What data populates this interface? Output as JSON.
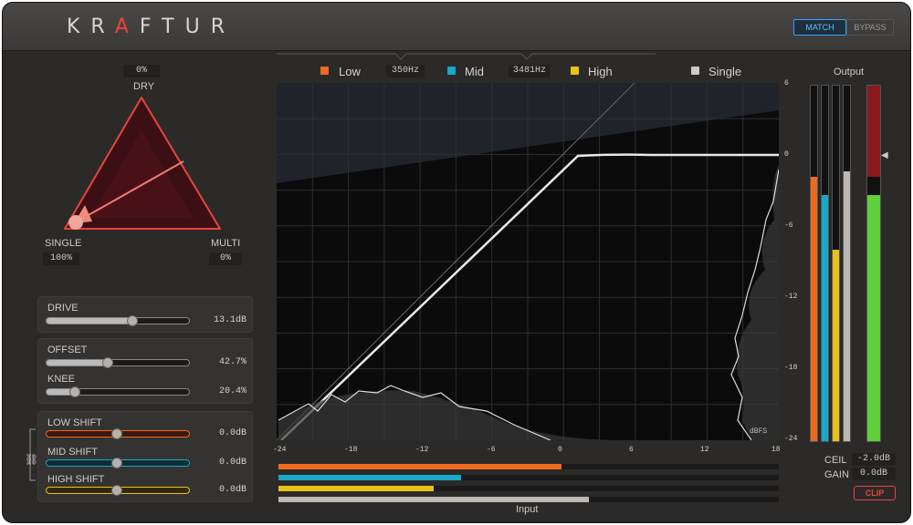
{
  "header": {
    "logo_left": "KR",
    "logo_accent": "A",
    "logo_right": "FTUR",
    "match_label": "MATCH",
    "bypass_label": "BYPASS"
  },
  "mix": {
    "dry_value": "0%",
    "dry_label": "DRY",
    "single_label": "SINGLE",
    "multi_label": "MULTI",
    "single_value": "100%",
    "multi_value": "0%"
  },
  "controls": {
    "drive_label": "DRIVE",
    "drive_value": "13.1dB",
    "drive_level": 0.6,
    "offset_label": "OFFSET",
    "offset_value": "42.7%",
    "offset_level": 0.43,
    "knee_label": "KNEE",
    "knee_value": "20.4%",
    "knee_level": 0.2,
    "low_shift_label": "LOW SHIFT",
    "low_shift_value": "0.0dB",
    "mid_shift_label": "MID SHIFT",
    "mid_shift_value": "0.0dB",
    "high_shift_label": "HIGH SHIFT",
    "high_shift_value": "0.0dB"
  },
  "bands": {
    "low_label": "Low",
    "low_freq": "350Hz",
    "mid_label": "Mid",
    "mid_freq": "3481Hz",
    "high_label": "High",
    "single_label": "Single"
  },
  "graph": {
    "x_ticks": [
      "-24",
      "-18",
      "-12",
      "-6",
      "0",
      "6",
      "12",
      "18"
    ],
    "y_ticks": [
      "6",
      "0",
      "-6",
      "-12",
      "-18",
      "-24"
    ],
    "dbfs_label": "dBFS",
    "input_label": "Input"
  },
  "output": {
    "title": "Output",
    "ceil_label": "CEIL",
    "ceil_value": "-2.0dB",
    "gain_label": "GAIN",
    "gain_value": "0.0dB",
    "clip_label": "CLIP"
  },
  "colors": {
    "low": "#f06a1e",
    "mid": "#18a8c8",
    "high": "#e8c21a",
    "single": "#cfcac5",
    "accent": "#e8453a",
    "output_green": "#5fd03a"
  }
}
